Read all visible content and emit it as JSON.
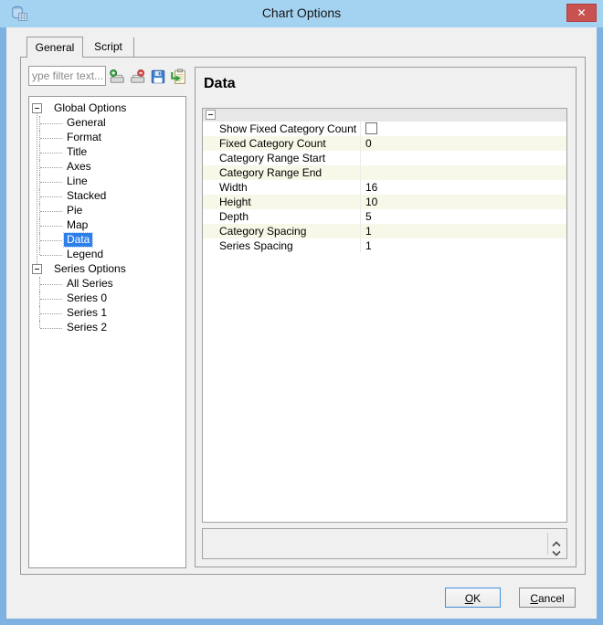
{
  "window": {
    "title": "Chart Options",
    "close_glyph": "✕"
  },
  "tabs": {
    "general": "General",
    "script": "Script"
  },
  "toolbar": {
    "filter_placeholder": "ype filter text...",
    "icons": [
      "import-template-icon",
      "remove-template-icon",
      "save-icon",
      "apply-template-icon"
    ]
  },
  "tree": {
    "global": {
      "label": "Global Options",
      "children": [
        "General",
        "Format",
        "Title",
        "Axes",
        "Line",
        "Stacked",
        "Pie",
        "Map",
        "Data",
        "Legend"
      ]
    },
    "series": {
      "label": "Series Options",
      "children": [
        "All Series",
        "Series 0",
        "Series 1",
        "Series 2"
      ]
    },
    "selected": "Data"
  },
  "panel": {
    "title": "Data",
    "properties": [
      {
        "label": "Show Fixed Category Count",
        "value": "",
        "control": "checkbox",
        "checked": false
      },
      {
        "label": "Fixed Category Count",
        "value": "0"
      },
      {
        "label": "Category Range Start",
        "value": ""
      },
      {
        "label": "Category Range End",
        "value": ""
      },
      {
        "label": "Width",
        "value": "16"
      },
      {
        "label": "Height",
        "value": "10"
      },
      {
        "label": "Depth",
        "value": "5"
      },
      {
        "label": "Category Spacing",
        "value": "1"
      },
      {
        "label": "Series Spacing",
        "value": "1"
      }
    ]
  },
  "buttons": {
    "ok_head": "O",
    "ok_tail": "K",
    "cancel_head": "C",
    "cancel_tail": "ancel"
  },
  "colors": {
    "frame": "#7fb2e2",
    "titlebar": "#a4d3f2",
    "close_red": "#c85250",
    "selection": "#2e7fe8",
    "row_alt": "#f8f8e8",
    "panel_bg": "#f0f0f0"
  }
}
